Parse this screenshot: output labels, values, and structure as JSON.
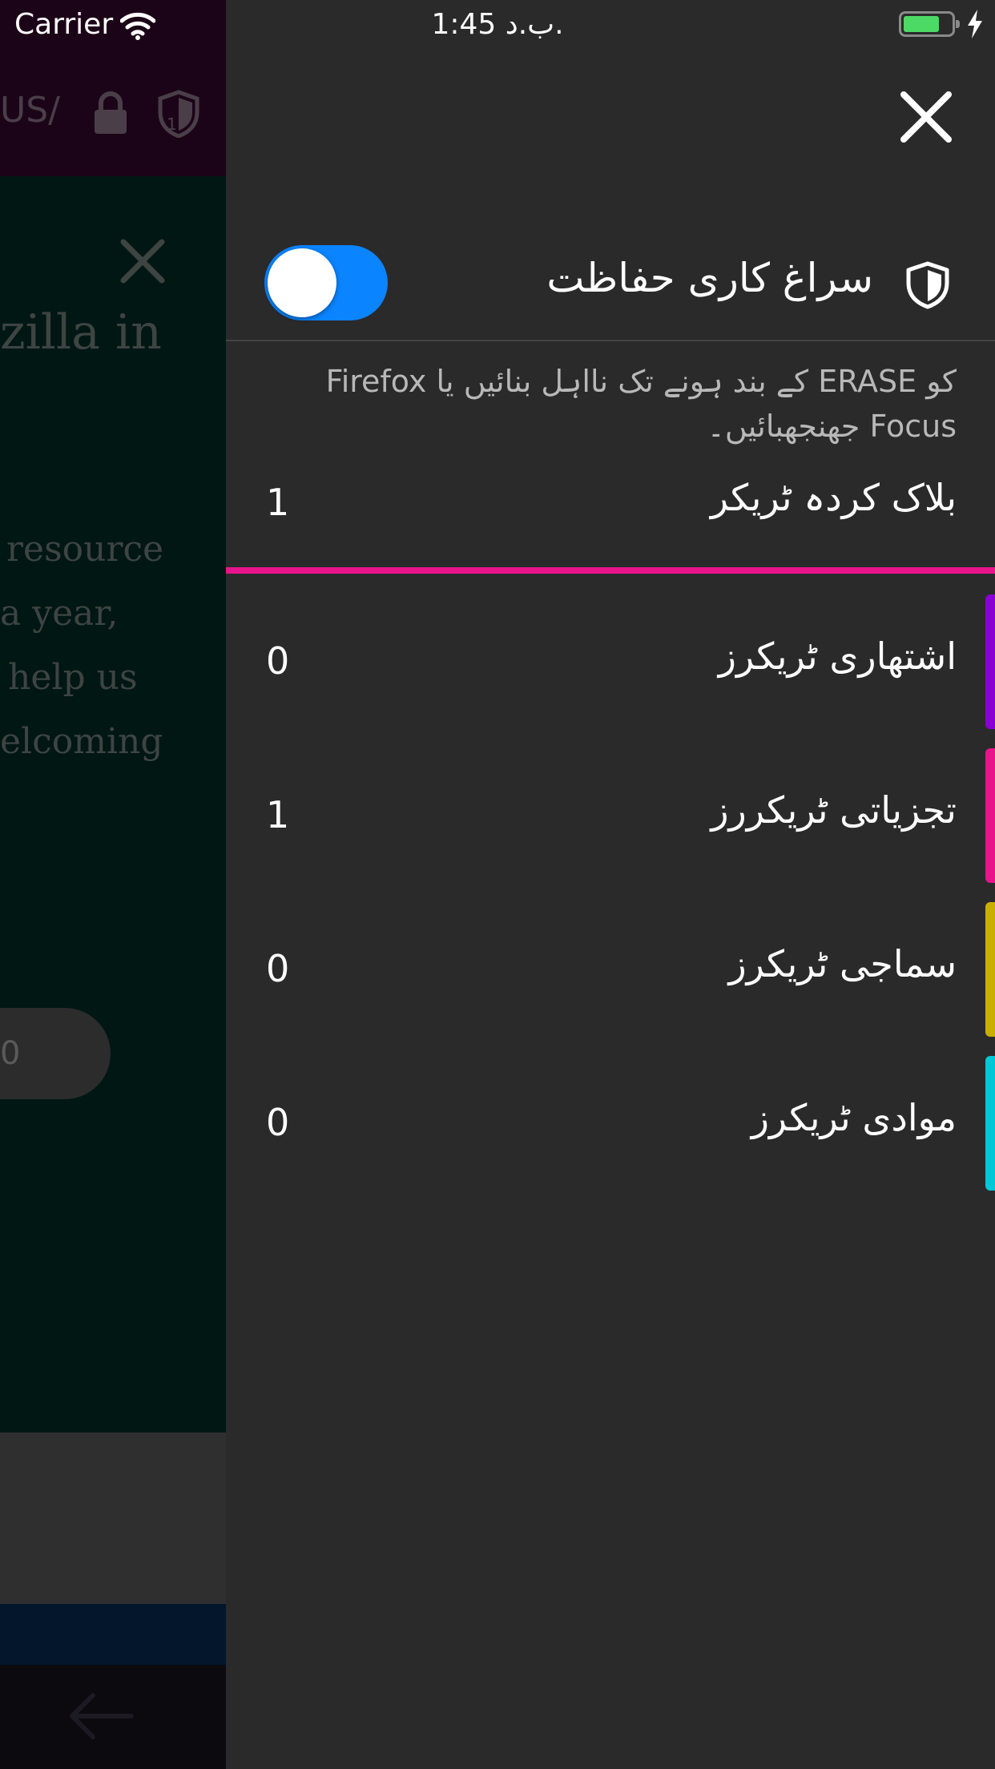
{
  "status_bar": {
    "carrier": "Carrier",
    "time": "1:45 ب.د."
  },
  "background_page": {
    "url_fragment": "US/",
    "tracker_badge": "1",
    "headline_fragment": "zilla in",
    "paragraph_lines": [
      "resource",
      "a year,",
      "help us",
      "elcoming"
    ],
    "button_fragment": "0"
  },
  "panel": {
    "title": "سراغ کاری حفاظت",
    "toggle_on": true,
    "description": "کو ERASE کے بند ہونے تک نااہل بنائیں یا Firefox Focus جھنجھبائیں۔",
    "blocked": {
      "label": "بلاک کردہ ٹریکر",
      "count": "1"
    },
    "categories": [
      {
        "label": "اشتھاری ٹریکرز",
        "count": "0",
        "color": "#8a00d4"
      },
      {
        "label": "تجزیاتی ٹریکررز",
        "count": "1",
        "color": "#e9148b"
      },
      {
        "label": "سماجی ٹریکرز",
        "count": "0",
        "color": "#c9b000"
      },
      {
        "label": "موادی ٹریکرز",
        "count": "0",
        "color": "#00c8d7"
      }
    ],
    "divider_color": "#e9148b",
    "toggle_color": "#0a84ff"
  }
}
